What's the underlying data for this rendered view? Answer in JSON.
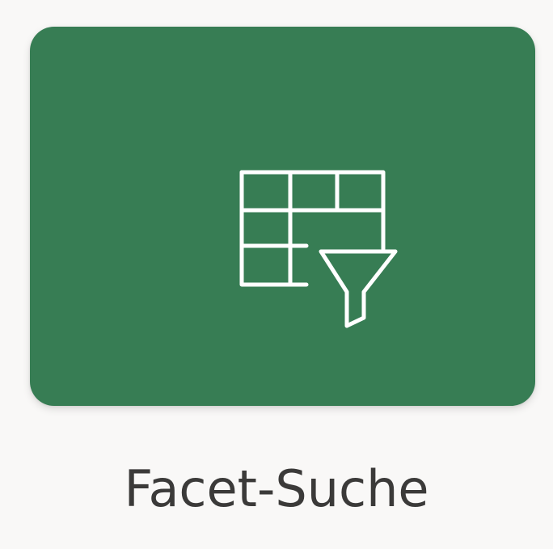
{
  "tile": {
    "label": "Facet-Suche",
    "icon": "table-filter-icon",
    "background_color": "#377d54",
    "icon_color": "#ffffff",
    "label_color": "#3b3a39"
  }
}
